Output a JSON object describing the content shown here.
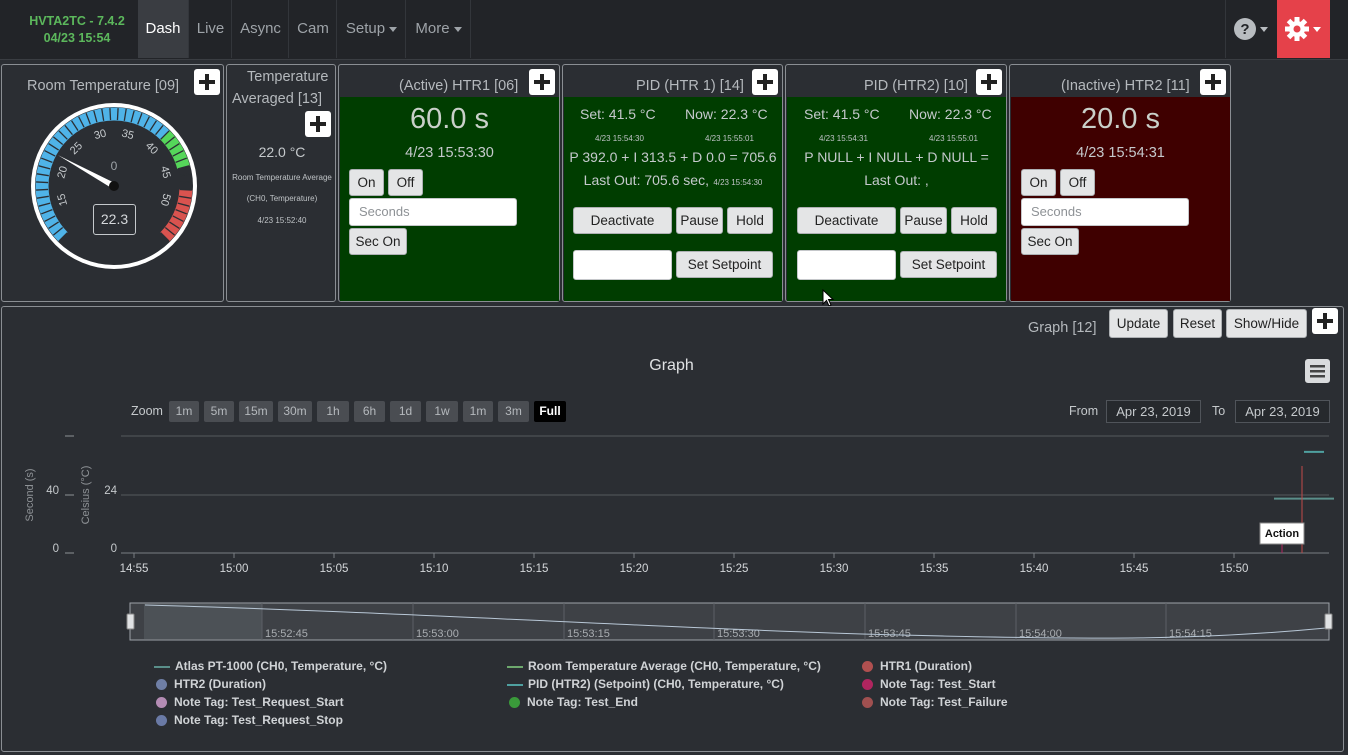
{
  "navbar": {
    "brand_line1": "HVTA2TC - 7.4.2",
    "brand_line2": "04/23 15:54",
    "items": [
      {
        "label": "Dash"
      },
      {
        "label": "Live"
      },
      {
        "label": "Async"
      },
      {
        "label": "Cam"
      },
      {
        "label": "Setup"
      },
      {
        "label": "More"
      }
    ]
  },
  "gauge": {
    "title": "Room Temperature [09]",
    "value": "22.3",
    "value_num": 22.3,
    "center_label": "0",
    "min": 10,
    "max": 55,
    "ticks": [
      "15",
      "20",
      "25",
      "30",
      "35",
      "40",
      "45",
      "50"
    ],
    "colors": {
      "low": "#4fb3e8",
      "mid": "#ffffff",
      "high_warn": "#55d65a",
      "high": "#d9534f"
    }
  },
  "avg": {
    "title_line1": "Temperature",
    "title_line2": "Averaged [13]",
    "value": "22.0 °C",
    "desc_line1": "Room Temperature Average",
    "desc_line2": "(CH0, Temperature)",
    "timestamp": "4/23 15:52:40"
  },
  "htr1": {
    "title": "(Active) HTR1 [06]",
    "duration": "60.0 s",
    "timestamp": "4/23 15:53:30",
    "on_label": "On",
    "off_label": "Off",
    "seconds_placeholder": "Seconds",
    "sec_on_label": "Sec On"
  },
  "pid1": {
    "title": "PID (HTR 1) [14]",
    "set": "Set: 41.5 °C",
    "now": "Now: 22.3 °C",
    "set_ts": "4/23 15:54:30",
    "now_ts": "4/23 15:55:01",
    "equation": "P 392.0 + I 313.5 + D 0.0 = 705.6",
    "last_out": "Last Out: 705.6 sec,",
    "last_out_ts": "4/23 15:54:30",
    "deactivate_label": "Deactivate",
    "pause_label": "Pause",
    "hold_label": "Hold",
    "set_setpoint_label": "Set Setpoint"
  },
  "pid2": {
    "title": "PID (HTR2) [10]",
    "set": "Set: 41.5 °C",
    "now": "Now: 22.3 °C",
    "set_ts": "4/23 15:54:31",
    "now_ts": "4/23 15:55:01",
    "equation": "P NULL + I NULL + D NULL =",
    "last_out": "Last Out: ,",
    "deactivate_label": "Deactivate",
    "pause_label": "Pause",
    "hold_label": "Hold",
    "set_setpoint_label": "Set Setpoint"
  },
  "htr2": {
    "title": "(Inactive) HTR2 [11]",
    "duration": "20.0 s",
    "timestamp": "4/23 15:54:31",
    "on_label": "On",
    "off_label": "Off",
    "seconds_placeholder": "Seconds",
    "sec_on_label": "Sec On"
  },
  "graph_panel": {
    "title": "Graph [12]",
    "update_label": "Update",
    "reset_label": "Reset",
    "showhide_label": "Show/Hide",
    "chart_title": "Graph",
    "zoom_label": "Zoom",
    "zoom_buttons": [
      "1m",
      "5m",
      "15m",
      "30m",
      "1h",
      "6h",
      "1d",
      "1w",
      "1m",
      "3m",
      "Full"
    ],
    "zoom_selected": "Full",
    "from_label": "From",
    "from_value": "Apr 23, 2019",
    "to_label": "To",
    "to_value": "Apr 23, 2019",
    "y1_label": "Second (s)",
    "y2_label": "Celsius (°C)",
    "y1_ticks": [
      "40",
      "0"
    ],
    "y2_ticks": [
      "24",
      "0"
    ],
    "x_ticks": [
      "14:55",
      "15:00",
      "15:05",
      "15:10",
      "15:15",
      "15:20",
      "15:25",
      "15:30",
      "15:35",
      "15:40",
      "15:45",
      "15:50"
    ],
    "flag_label": "Action",
    "nav_ticks": [
      "15:52:45",
      "15:53:00",
      "15:53:15",
      "15:53:30",
      "15:53:45",
      "15:54:00",
      "15:54:15"
    ]
  },
  "legend": [
    {
      "label": "Atlas PT-1000 (CH0, Temperature, °C)",
      "kind": "line",
      "color": "#5a8f8a"
    },
    {
      "label": "Room Temperature Average (CH0, Temperature, °C)",
      "kind": "line",
      "color": "#6da86d"
    },
    {
      "label": "HTR1 (Duration)",
      "kind": "dot",
      "color": "#b05050"
    },
    {
      "label": "HTR2 (Duration)",
      "kind": "dot",
      "color": "#6f7fa6"
    },
    {
      "label": "PID (HTR2) (Setpoint) (CH0, Temperature, °C)",
      "kind": "line",
      "color": "#4fa0a0"
    },
    {
      "label": "Note Tag: Test_Start",
      "kind": "dot",
      "color": "#b0255f"
    },
    {
      "label": "Note Tag: Test_Request_Start",
      "kind": "dot",
      "color": "#b48cb4"
    },
    {
      "label": "Note Tag: Test_End",
      "kind": "dot",
      "color": "#3a9a3a"
    },
    {
      "label": "Note Tag: Test_Failure",
      "kind": "dot",
      "color": "#a05050"
    },
    {
      "label": "Note Tag: Test_Request_Stop",
      "kind": "dot",
      "color": "#6a7aa6"
    }
  ],
  "chart_data": {
    "type": "line",
    "title": "Graph",
    "xlabel": "",
    "ylabel": "Celsius (°C)",
    "x_range": [
      "14:55",
      "15:55"
    ],
    "ylim": [
      0,
      48
    ],
    "series": [
      {
        "name": "PID (HTR2) (Setpoint) (CH0, Temperature, °C)",
        "x": [
          "15:53",
          "15:54"
        ],
        "values": [
          41.5,
          41.5
        ]
      },
      {
        "name": "Atlas PT-1000 (CH0, Temperature, °C)",
        "x": [
          "15:52",
          "15:55"
        ],
        "values": [
          22.3,
          22.3
        ]
      }
    ],
    "flags": [
      {
        "x": "15:53",
        "label": "Action"
      }
    ]
  }
}
